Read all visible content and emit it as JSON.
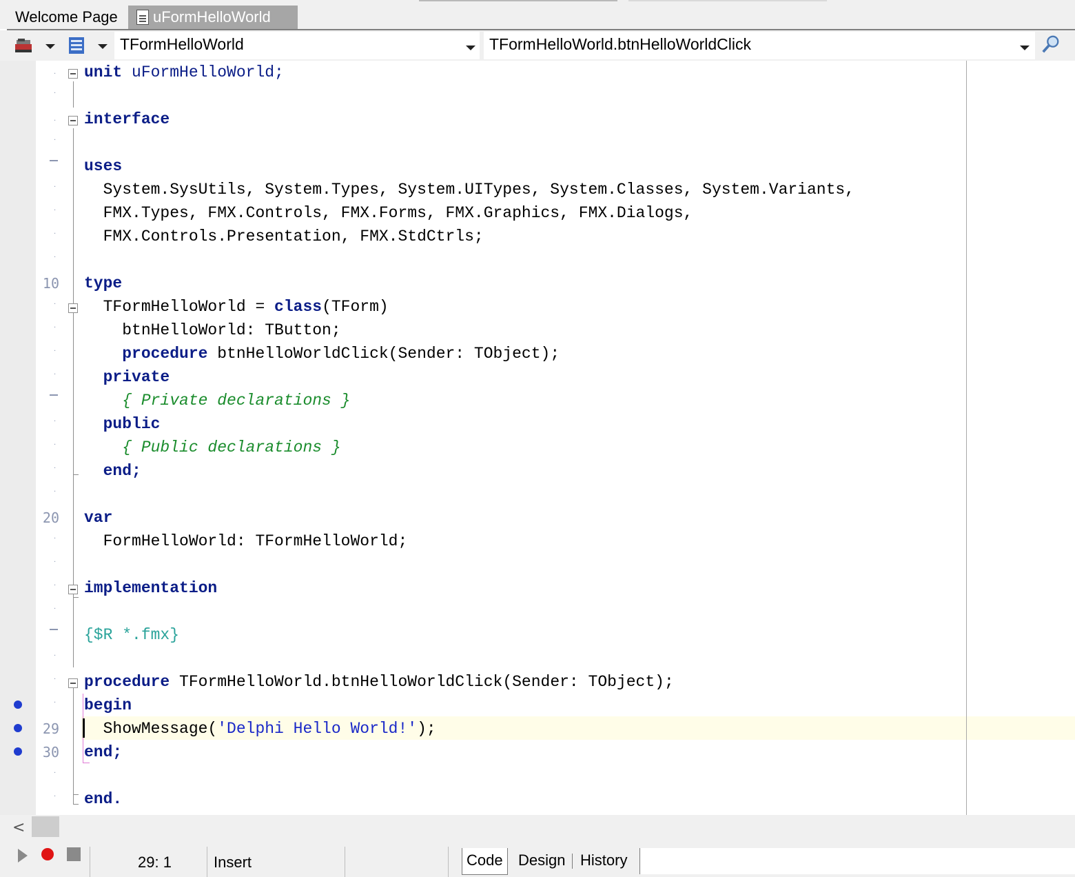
{
  "tabs": {
    "welcome": "Welcome Page",
    "active": "uFormHelloWorld"
  },
  "toolbar": {
    "class_combo": "TFormHelloWorld",
    "method_combo": "TFormHelloWorld.btnHelloWorldClick"
  },
  "editor": {
    "line_numbers": {
      "l10": "10",
      "l20": "20",
      "l29": "29",
      "l30": "30"
    },
    "code": {
      "l1_kw": "unit",
      "l1_rest": " uFormHelloWorld;",
      "l3": "interface",
      "l5": "uses",
      "l6": "  System.SysUtils, System.Types, System.UITypes, System.Classes, System.Variants,",
      "l7": "  FMX.Types, FMX.Controls, FMX.Forms, FMX.Graphics, FMX.Dialogs,",
      "l8": "  FMX.Controls.Presentation, FMX.StdCtrls;",
      "l10": "type",
      "l11_a": "  TFormHelloWorld = ",
      "l11_kw": "class",
      "l11_b": "(TForm)",
      "l12": "    btnHelloWorld: TButton;",
      "l13_kw": "    procedure",
      "l13_rest": " btnHelloWorldClick(Sender: TObject);",
      "l14": "  private",
      "l15": "    { Private declarations }",
      "l16": "  public",
      "l17": "    { Public declarations }",
      "l18": "  end;",
      "l20": "var",
      "l21": "  FormHelloWorld: TFormHelloWorld;",
      "l23": "implementation",
      "l25": "{$R *.fmx}",
      "l27_kw": "procedure",
      "l27_rest": " TFormHelloWorld.btnHelloWorldClick(Sender: TObject);",
      "l28": "begin",
      "l29_a": "  ShowMessage(",
      "l29_str": "'Delphi Hello World!'",
      "l29_b": ");",
      "l30": "end;",
      "l32": "end."
    }
  },
  "statusbar": {
    "position": "29:  1",
    "mode": "Insert",
    "view_tabs": {
      "code": "Code",
      "design": "Design",
      "history": "History"
    }
  },
  "colors": {
    "keyword": "#0b1d87",
    "comment": "#1a8c2c",
    "directive": "#2aa39a",
    "string": "#1a28c8",
    "breakpoint": "#1f3ccf",
    "current_line": "#fffde8"
  }
}
